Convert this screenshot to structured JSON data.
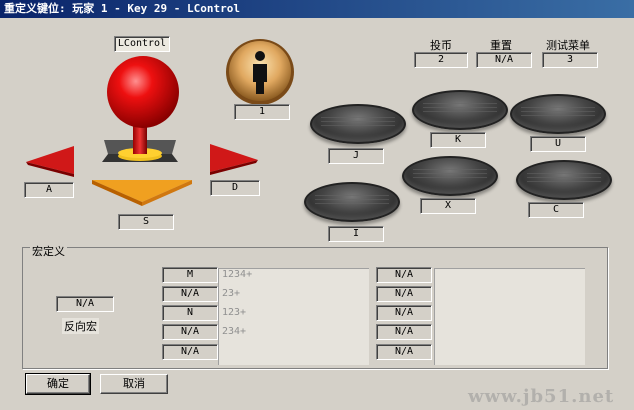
{
  "window": {
    "title": "重定义键位: 玩家 1 - Key 29 - LControl"
  },
  "joystick": {
    "key_label": "LControl",
    "up": "",
    "down": "S",
    "left": "A",
    "right": "D"
  },
  "player_button": {
    "value": "1"
  },
  "system_buttons": [
    {
      "label": "投币",
      "value": "2"
    },
    {
      "label": "重置",
      "value": "N/A"
    },
    {
      "label": "测试菜单",
      "value": "3"
    }
  ],
  "action_buttons": [
    {
      "value": "J"
    },
    {
      "value": "K"
    },
    {
      "value": "U"
    },
    {
      "value": "I"
    },
    {
      "value": "X"
    },
    {
      "value": "C"
    }
  ],
  "macro": {
    "group_label": "宏定义",
    "reverse_value": "N/A",
    "reverse_label": "反向宏",
    "left_keys": [
      "M",
      "N/A",
      "N",
      "N/A",
      "N/A"
    ],
    "left_texts": [
      "1234+",
      "23+",
      "123+",
      "234+",
      ""
    ],
    "right_keys": [
      "N/A",
      "N/A",
      "N/A",
      "N/A",
      "N/A"
    ]
  },
  "footer": {
    "ok_label": "确定",
    "cancel_label": "取消",
    "watermark": "www.jb51.net"
  },
  "colors": {
    "title_bg": "#0a246a",
    "dialog_bg": "#d4d0c8",
    "arrow_red": "#d01818",
    "arrow_orange": "#f0a020",
    "ball_red": "#e00000"
  }
}
